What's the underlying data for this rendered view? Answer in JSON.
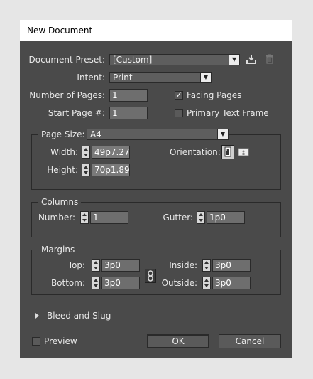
{
  "window": {
    "title": "New Document"
  },
  "preset": {
    "label": "Document Preset:",
    "value": "[Custom]",
    "save_icon": "download-icon",
    "delete_icon": "trash-icon"
  },
  "intent": {
    "label": "Intent:",
    "value": "Print"
  },
  "pages": {
    "number_label": "Number of Pages:",
    "number_value": "1",
    "start_label": "Start Page #:",
    "start_value": "1",
    "facing_label": "Facing Pages",
    "facing_checked": true,
    "primary_label": "Primary Text Frame",
    "primary_checked": false
  },
  "page_size": {
    "label": "Page Size:",
    "value": "A4",
    "width_label": "Width:",
    "width_value": "49p7.276",
    "height_label": "Height:",
    "height_value": "70p1.89",
    "orientation_label": "Orientation:",
    "orientation_icons": [
      "portrait-icon",
      "landscape-icon"
    ]
  },
  "columns": {
    "title": "Columns",
    "number_label": "Number:",
    "number_value": "1",
    "gutter_label": "Gutter:",
    "gutter_value": "1p0"
  },
  "margins": {
    "title": "Margins",
    "top_label": "Top:",
    "top_value": "3p0",
    "bottom_label": "Bottom:",
    "bottom_value": "3p0",
    "inside_label": "Inside:",
    "inside_value": "3p0",
    "outside_label": "Outside:",
    "outside_value": "3p0",
    "link_icon": "chain-link-icon"
  },
  "bleed": {
    "label": "Bleed and Slug"
  },
  "preview": {
    "label": "Preview",
    "checked": false
  },
  "buttons": {
    "ok": "OK",
    "cancel": "Cancel"
  }
}
